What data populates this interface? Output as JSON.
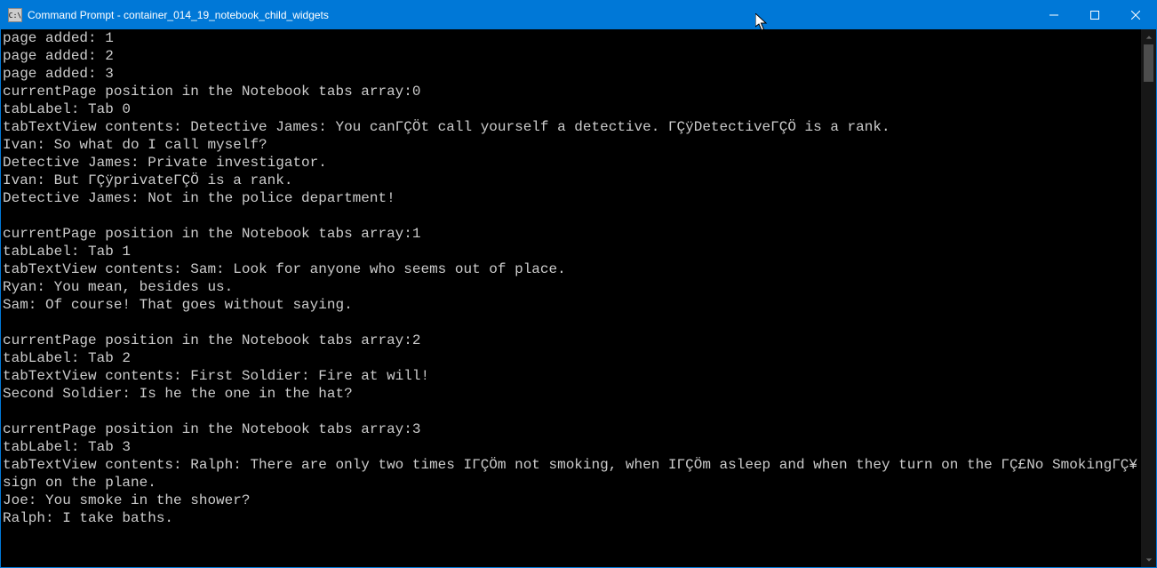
{
  "titlebar": {
    "icon_text": "C:\\",
    "title": "Command Prompt - container_014_19_notebook_child_widgets"
  },
  "terminal": {
    "lines": [
      "page added: 1",
      "page added: 2",
      "page added: 3",
      "currentPage position in the Notebook tabs array:0",
      "tabLabel: Tab 0",
      "tabTextView contents: Detective James: You canΓÇÖt call yourself a detective. ΓÇÿDetectiveΓÇÖ is a rank.",
      "Ivan: So what do I call myself?",
      "Detective James: Private investigator.",
      "Ivan: But ΓÇÿprivateΓÇÖ is a rank.",
      "Detective James: Not in the police department!",
      "",
      "currentPage position in the Notebook tabs array:1",
      "tabLabel: Tab 1",
      "tabTextView contents: Sam: Look for anyone who seems out of place.",
      "Ryan: You mean, besides us.",
      "Sam: Of course! That goes without saying.",
      "",
      "currentPage position in the Notebook tabs array:2",
      "tabLabel: Tab 2",
      "tabTextView contents: First Soldier: Fire at will!",
      "Second Soldier: Is he the one in the hat?",
      "",
      "currentPage position in the Notebook tabs array:3",
      "tabLabel: Tab 3",
      "tabTextView contents: Ralph: There are only two times IΓÇÖm not smoking, when IΓÇÖm asleep and when they turn on the ΓÇ£No SmokingΓÇ¥ sign on the plane.",
      "Joe: You smoke in the shower?",
      "Ralph: I take baths."
    ]
  }
}
